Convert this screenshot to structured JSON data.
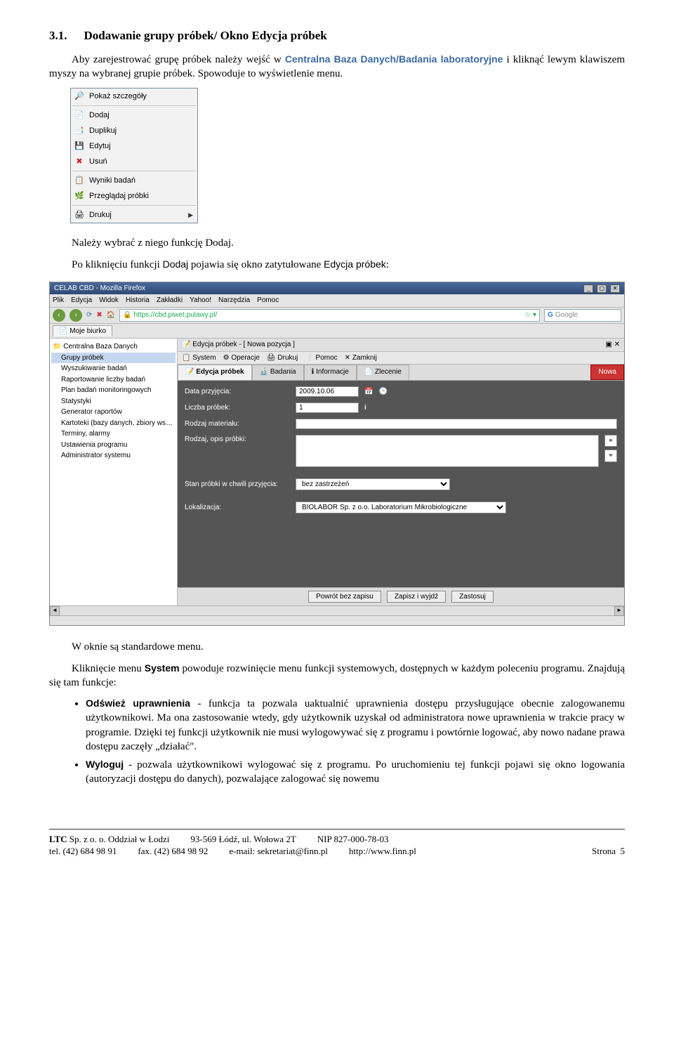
{
  "heading": {
    "number": "3.1.",
    "title": "Dodawanie grupy próbek/ Okno Edycja próbek"
  },
  "intro": {
    "p1a": "Aby zarejestrować grupę próbek należy wejść w ",
    "p1b": "Centralna Baza Danych/Badania laboratoryjne",
    "p1c": " i kliknąć lewym klawiszem myszy na wybranej grupie próbek. Spowoduje to wyświetlenie menu."
  },
  "ctx": {
    "items": [
      {
        "icon": "🔎",
        "label": "Pokaż szczegóły"
      },
      {
        "icon": "📄",
        "label": "Dodaj"
      },
      {
        "icon": "📑",
        "label": "Duplikuj"
      },
      {
        "icon": "💾",
        "label": "Edytuj"
      },
      {
        "icon": "✖",
        "label": "Usuń",
        "iconColor": "#c22"
      },
      {
        "sep": true
      },
      {
        "icon": "📋",
        "label": "Wyniki badań"
      },
      {
        "icon": "🌿",
        "label": "Przeglądaj próbki"
      },
      {
        "sep": true
      },
      {
        "icon": "🖨",
        "label": "Drukuj",
        "arrow": "▶"
      }
    ]
  },
  "p2a": "Należy wybrać z niego funkcję Dodaj.",
  "p2b_a": "Po kliknięciu funkcji ",
  "p2b_b": "Dodaj",
  "p2b_c": " pojawia się okno zatytułowane ",
  "p2b_d": "Edycja próbek",
  "p2b_e": ":",
  "browser": {
    "title": "CELAB CBD - Mozilla Firefox",
    "menubar": [
      "Plik",
      "Edycja",
      "Widok",
      "Historia",
      "Zakładki",
      "Yahoo!",
      "Narzędzia",
      "Pomoc"
    ],
    "url": "https://cbd.piwet.pulawy.pl/",
    "search_placeholder": "Google",
    "tab": "Moje biurko",
    "tree": [
      {
        "label": "Centralna Baza Danych",
        "root": true
      },
      {
        "label": "Grupy próbek",
        "sel": true
      },
      {
        "label": "Wyszukiwanie badań"
      },
      {
        "label": "Raportowanie liczby badań"
      },
      {
        "label": "Plan badań monitoringowych"
      },
      {
        "label": "Statystyki"
      },
      {
        "label": "Generator raportów"
      },
      {
        "label": "Kartoteki (bazy danych, zbiory wspomag"
      },
      {
        "label": "Terminy, alarmy"
      },
      {
        "label": "Ustawienia programu"
      },
      {
        "label": "Administrator systemu"
      }
    ],
    "crumb": "Edycja próbek - [ Nowa pozycja ]",
    "subbar": [
      "System",
      "Operacje",
      "Drukuj",
      "Pomoc",
      "Zamknij"
    ],
    "tabs": [
      "Edycja próbek",
      "Badania",
      "Informacje",
      "Zlecenie"
    ],
    "tab_red": "Nowa",
    "form": {
      "data_label": "Data przyjęcia:",
      "data_val": "2009.10.06",
      "liczba_label": "Liczba próbek:",
      "liczba_val": "1",
      "rodzaj_mat_label": "Rodzaj materiału:",
      "rodzaj_opis_label": "Rodzaj, opis próbki:",
      "stan_label": "Stan próbki w chwili przyjęcia:",
      "stan_val": "bez zastrzeżeń",
      "lok_label": "Lokalizacja:",
      "lok_val": "BIOLABOR Sp. z o.o. Laboratorium Mikrobiologiczne"
    },
    "buttons": [
      "Powrót bez zapisu",
      "Zapisz i wyjdź",
      "Zastosuj"
    ]
  },
  "p3": "W oknie są standardowe menu.",
  "p4a": "Kliknięcie menu ",
  "p4b": "System",
  "p4c": " powoduje rozwinięcie menu funkcji systemowych, dostępnych w każdym poleceniu programu. Znajdują się tam funkcje:",
  "bullets": {
    "b1a": "Odśwież uprawnienia",
    "b1b": " - funkcja ta pozwala uaktualnić uprawnienia dostępu przysługujące obecnie zalogowanemu użytkownikowi. Ma ona zastosowanie wtedy, gdy użytkownik uzyskał od administratora nowe uprawnienia w trakcie pracy w programie. Dzięki tej funkcji użytkownik nie musi wylogowywać się z programu i powtórnie logować, aby nowo nadane prawa dostępu zaczęły „działać\".",
    "b2a": "Wyloguj",
    "b2b": " - pozwala użytkownikowi wylogować się z programu. Po uruchomieniu tej funkcji pojawi się okno logowania (autoryzacji dostępu do danych), pozwalające zalogować się nowemu"
  },
  "footer": {
    "company": "LTC",
    "company2": " Sp. z o. o. Oddział w Łodzi",
    "addr": "93-569 Łódź, ul. Wołowa 2T",
    "nip": "NIP 827-000-78-03",
    "tel": "tel. (42) 684 98 91",
    "fax": "fax. (42) 684 98 92",
    "email": "e-mail: sekretariat@finn.pl",
    "www": "http://www.finn.pl",
    "pageLabel": "Strona",
    "pageNum": "5"
  }
}
